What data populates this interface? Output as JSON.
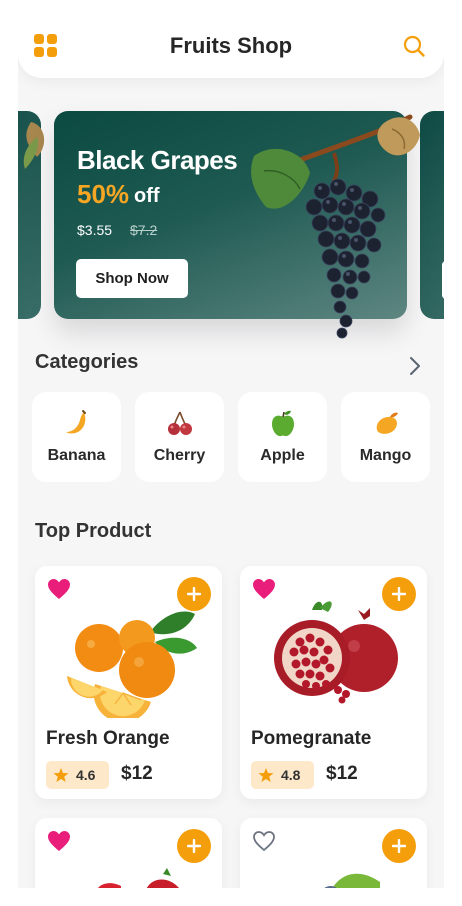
{
  "header": {
    "title": "Fruits Shop"
  },
  "banner": {
    "title": "Black Grapes",
    "discount": "50%",
    "off_label": "off",
    "price": "$3.55",
    "old_price": "$7.2",
    "button_label": "Shop Now"
  },
  "categories": {
    "title": "Categories",
    "items": [
      {
        "label": "Banana",
        "icon": "banana-icon"
      },
      {
        "label": "Cherry",
        "icon": "cherry-icon"
      },
      {
        "label": "Apple",
        "icon": "apple-icon"
      },
      {
        "label": "Mango",
        "icon": "mango-icon"
      }
    ]
  },
  "top_product": {
    "title": "Top Product",
    "items": [
      {
        "name": "Fresh Orange",
        "rating": "4.6",
        "price": "$12",
        "favorite": true
      },
      {
        "name": "Pomegranate",
        "rating": "4.8",
        "price": "$12",
        "favorite": true
      },
      {
        "name": "",
        "rating": "",
        "price": "",
        "favorite": true
      },
      {
        "name": "",
        "rating": "",
        "price": "",
        "favorite": false
      }
    ]
  },
  "colors": {
    "accent": "#f59e0b",
    "heart": "#e91e7a",
    "banner": "#0b4a41"
  }
}
